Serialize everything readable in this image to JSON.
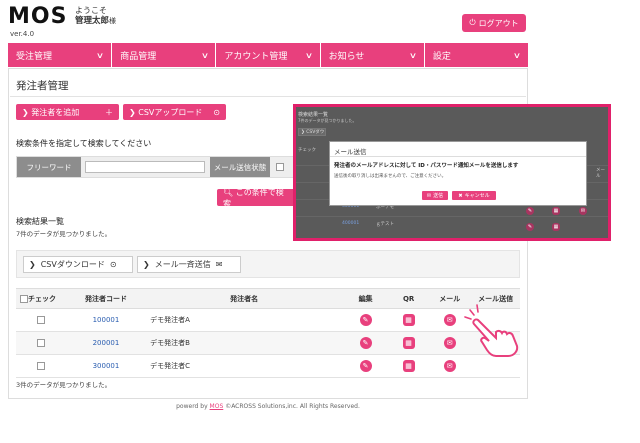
{
  "header": {
    "logo": "MOS",
    "version": "ver.4.0",
    "welcome": "ようこそ",
    "user_name": "管理太郎",
    "honorific": "様",
    "logout_label": "ログアウト"
  },
  "nav": [
    {
      "label": "受注管理"
    },
    {
      "label": "商品管理"
    },
    {
      "label": "アカウント管理"
    },
    {
      "label": "お知らせ"
    },
    {
      "label": "設定"
    }
  ],
  "page": {
    "title": "発注者管理",
    "add_button": "発注者を追加",
    "csv_upload_button": "CSVアップロード",
    "search_heading": "検索条件を指定して検索してください",
    "freeword_label": "フリーワード",
    "freeword_value": "",
    "mail_status_label": "メール送信状態",
    "search_button": "この条件で検索",
    "results_heading": "検索結果一覧",
    "results_count": "7件のデータが見つかりました。",
    "csv_download_button": "CSVダウンロード",
    "bulk_mail_button": "メール一斉送信",
    "bottom_count": "3件のデータが見つかりました。"
  },
  "table": {
    "headers": [
      "チェック",
      "発注者コード",
      "発注者名",
      "編集",
      "QR",
      "メール",
      "メール送信"
    ],
    "rows": [
      {
        "code": "100001",
        "name": "デモ発注者A"
      },
      {
        "code": "200001",
        "name": "デモ発注者B"
      },
      {
        "code": "300001",
        "name": "デモ発注者C"
      }
    ]
  },
  "dialog": {
    "title": "メール送信",
    "message": "発注者のメールアドレスに対して ID・パスワード通知メールを送信します",
    "note": "送信後の取り消しは出来ませんので、ご注意ください。",
    "send_button": "送信",
    "cancel_button": "キャンセル"
  },
  "inset_background": {
    "heading": "検索結果一覧",
    "count": "7件のデータが見つかりました。",
    "csv_button": "CSVダウ",
    "check_label": "チェック",
    "codes": [
      "100001",
      "200001",
      "300001",
      "400001"
    ],
    "names": [
      "デモ発注者A",
      "デモ発注者B",
      "ふーデモ",
      "ｇテスト"
    ],
    "mail_label": "メール"
  },
  "footer": {
    "prefix": "powerd by",
    "brand": "MOS",
    "suffix": "©ACROSS Solutions,inc. All Rights Reserved."
  },
  "colors": {
    "accent": "#e8407d",
    "inset_border": "#e0206a"
  }
}
